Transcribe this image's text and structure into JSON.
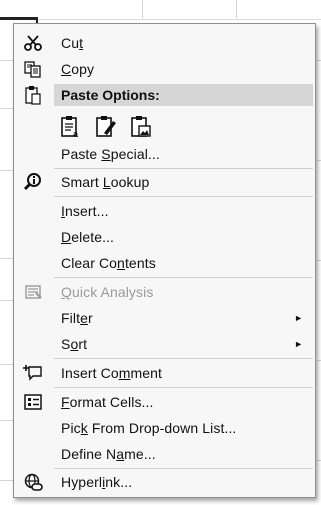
{
  "menu": {
    "items": [
      {
        "key": "cut",
        "pre": "Cu",
        "u": "t",
        "post": "",
        "icon": "scissors-icon",
        "enabled": true
      },
      {
        "key": "copy",
        "pre": "",
        "u": "C",
        "post": "opy",
        "icon": "copy-icon",
        "enabled": true
      },
      {
        "key": "paste_special",
        "pre": "Paste ",
        "u": "S",
        "post": "pecial...",
        "icon": "",
        "enabled": true
      },
      {
        "key": "smart_lookup",
        "pre": "Smart ",
        "u": "L",
        "post": "ookup",
        "icon": "smart-lookup-icon",
        "enabled": true
      },
      {
        "key": "insert",
        "pre": "",
        "u": "I",
        "post": "nsert...",
        "icon": "",
        "enabled": true
      },
      {
        "key": "delete",
        "pre": "",
        "u": "D",
        "post": "elete...",
        "icon": "",
        "enabled": true
      },
      {
        "key": "clear_contents",
        "pre": "Clear Co",
        "u": "n",
        "post": "tents",
        "icon": "",
        "enabled": true
      },
      {
        "key": "quick_analysis",
        "pre": "",
        "u": "Q",
        "post": "uick Analysis",
        "icon": "quick-analysis-icon",
        "enabled": false
      },
      {
        "key": "filter",
        "pre": "Filt",
        "u": "e",
        "post": "r",
        "icon": "",
        "enabled": true,
        "submenu": true
      },
      {
        "key": "sort",
        "pre": "S",
        "u": "o",
        "post": "rt",
        "icon": "",
        "enabled": true,
        "submenu": true
      },
      {
        "key": "insert_comment",
        "pre": "Insert Co",
        "u": "m",
        "post": "ment",
        "icon": "insert-comment-icon",
        "enabled": true
      },
      {
        "key": "format_cells",
        "pre": "",
        "u": "F",
        "post": "ormat Cells...",
        "icon": "format-cells-icon",
        "enabled": true
      },
      {
        "key": "pick_list",
        "pre": "Pic",
        "u": "k",
        "post": " From Drop-down List...",
        "icon": "",
        "enabled": true
      },
      {
        "key": "define_name",
        "pre": "Define N",
        "u": "a",
        "post": "me...",
        "icon": "",
        "enabled": true
      },
      {
        "key": "hyperlink",
        "pre": "Hyperl",
        "u": "i",
        "post": "nk...",
        "icon": "hyperlink-icon",
        "enabled": true
      }
    ],
    "paste_header": "Paste Options:",
    "paste_options": [
      {
        "name": "paste-icon"
      },
      {
        "name": "paste-formatting-icon"
      },
      {
        "name": "paste-picture-icon"
      }
    ],
    "submenu_arrow": "►"
  }
}
